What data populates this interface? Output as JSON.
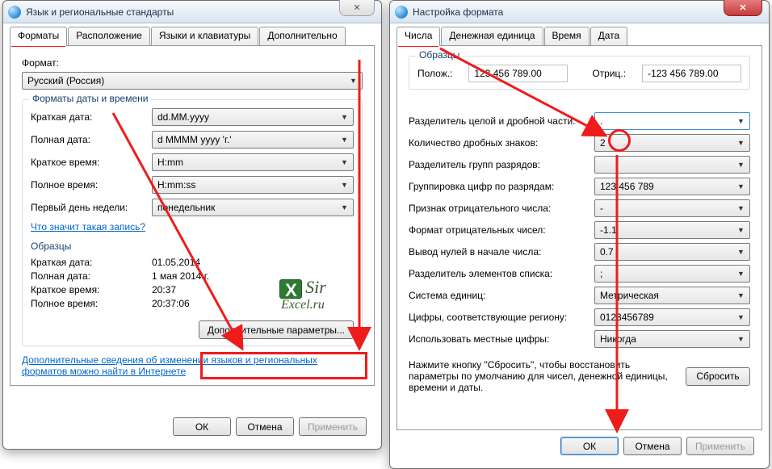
{
  "win1": {
    "title": "Язык и региональные стандарты",
    "tabs": [
      "Форматы",
      "Расположение",
      "Языки и клавиатуры",
      "Дополнительно"
    ],
    "format_label": "Формат:",
    "format_value": "Русский (Россия)",
    "datetime_group": "Форматы даты и времени",
    "rows": {
      "short_date_label": "Краткая дата:",
      "short_date_value": "dd.MM.yyyy",
      "long_date_label": "Полная дата:",
      "long_date_value": "d MMMM yyyy 'г.'",
      "short_time_label": "Краткое время:",
      "short_time_value": "H:mm",
      "long_time_label": "Полное время:",
      "long_time_value": "H:mm:ss",
      "first_day_label": "Первый день недели:",
      "first_day_value": "понедельник"
    },
    "what_link": "Что значит такая запись?",
    "samples_title": "Образцы",
    "samples": {
      "short_date_l": "Краткая дата:",
      "short_date_v": "01.05.2014",
      "long_date_l": "Полная дата:",
      "long_date_v": "1 мая 2014 г.",
      "short_time_l": "Краткое время:",
      "short_time_v": "20:37",
      "long_time_l": "Полное время:",
      "long_time_v": "20:37:06"
    },
    "more_button": "Дополнительные параметры...",
    "info_link": "Дополнительные сведения об изменении языков и региональных форматов можно найти в Интернете",
    "ok": "ОК",
    "cancel": "Отмена",
    "apply": "Применить"
  },
  "win2": {
    "title": "Настройка формата",
    "close": "X",
    "tabs": [
      "Числа",
      "Денежная единица",
      "Время",
      "Дата"
    ],
    "samples_title": "Образцы",
    "pos_label": "Полож.:",
    "pos_value": "123 456 789.00",
    "neg_label": "Отриц.:",
    "neg_value": "-123 456 789.00",
    "rows": {
      "decimal_sep_l": "Разделитель целой и дробной части:",
      "decimal_sep_v": ".",
      "decimals_l": "Количество дробных знаков:",
      "decimals_v": "2",
      "group_sep_l": "Разделитель групп разрядов:",
      "group_sep_v": "",
      "grouping_l": "Группировка цифр по разрядам:",
      "grouping_v": "123 456 789",
      "neg_sign_l": "Признак отрицательного числа:",
      "neg_sign_v": "-",
      "neg_fmt_l": "Формат отрицательных чисел:",
      "neg_fmt_v": "-1.1",
      "lead_zero_l": "Вывод нулей в начале числа:",
      "lead_zero_v": "0.7",
      "list_sep_l": "Разделитель элементов списка:",
      "list_sep_v": ";",
      "measure_l": "Система единиц:",
      "measure_v": "Метрическая",
      "digits_l": "Цифры, соответствующие региону:",
      "digits_v": "0123456789",
      "native_l": "Использовать местные цифры:",
      "native_v": "Никогда"
    },
    "reset_text": "Нажмите кнопку \"Сбросить\", чтобы восстановить параметры по умолчанию для чисел, денежной единицы, времени и даты.",
    "reset": "Сбросить",
    "ok": "ОК",
    "cancel": "Отмена",
    "apply": "Применить"
  },
  "logo": {
    "line1": "Sir",
    "line2": "Excel.ru"
  }
}
